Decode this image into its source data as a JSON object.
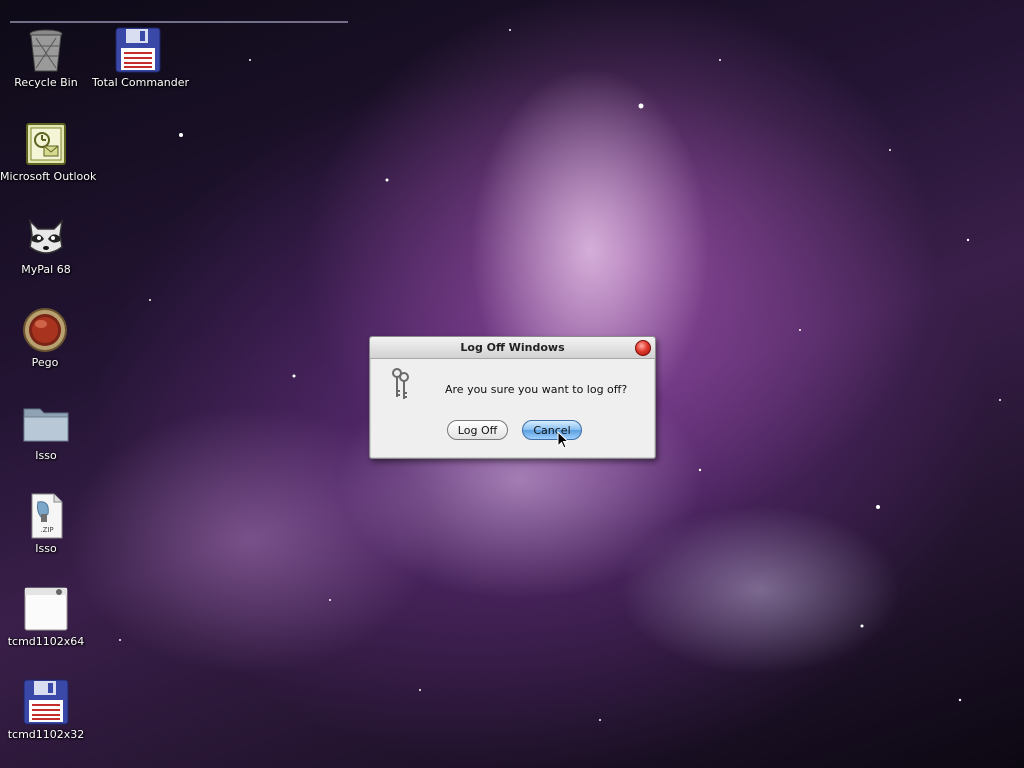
{
  "desktop": {
    "icons": [
      {
        "id": "recycle-bin",
        "label": "Recycle Bin",
        "icon": "recycle-bin-icon"
      },
      {
        "id": "total-commander",
        "label": "Total Commander",
        "icon": "floppy-disk-icon"
      },
      {
        "id": "microsoft-outlook",
        "label": "Microsoft Outlook",
        "icon": "outlook-icon"
      },
      {
        "id": "mypal",
        "label": "MyPal 68",
        "icon": "raccoon-icon"
      },
      {
        "id": "pego",
        "label": "Pego",
        "icon": "pego-orb-icon"
      },
      {
        "id": "isso-folder",
        "label": "Isso",
        "icon": "folder-icon"
      },
      {
        "id": "isso-zip",
        "label": "Isso",
        "icon": "zip-file-icon"
      },
      {
        "id": "tcmd1102x64",
        "label": "tcmd1102x64",
        "icon": "installer-window-icon"
      },
      {
        "id": "tcmd1102x32",
        "label": "tcmd1102x32",
        "icon": "floppy-disk-icon"
      }
    ]
  },
  "dialog": {
    "title": "Log Off Windows",
    "message": "Are you sure you want to log off?",
    "icon": "keys-icon",
    "buttons": {
      "logoff": "Log Off",
      "cancel": "Cancel"
    },
    "default_button": "cancel"
  },
  "colors": {
    "dialog_bg": "#efefef",
    "close_button": "#e23a2e",
    "default_button": "#8cc2f2"
  }
}
